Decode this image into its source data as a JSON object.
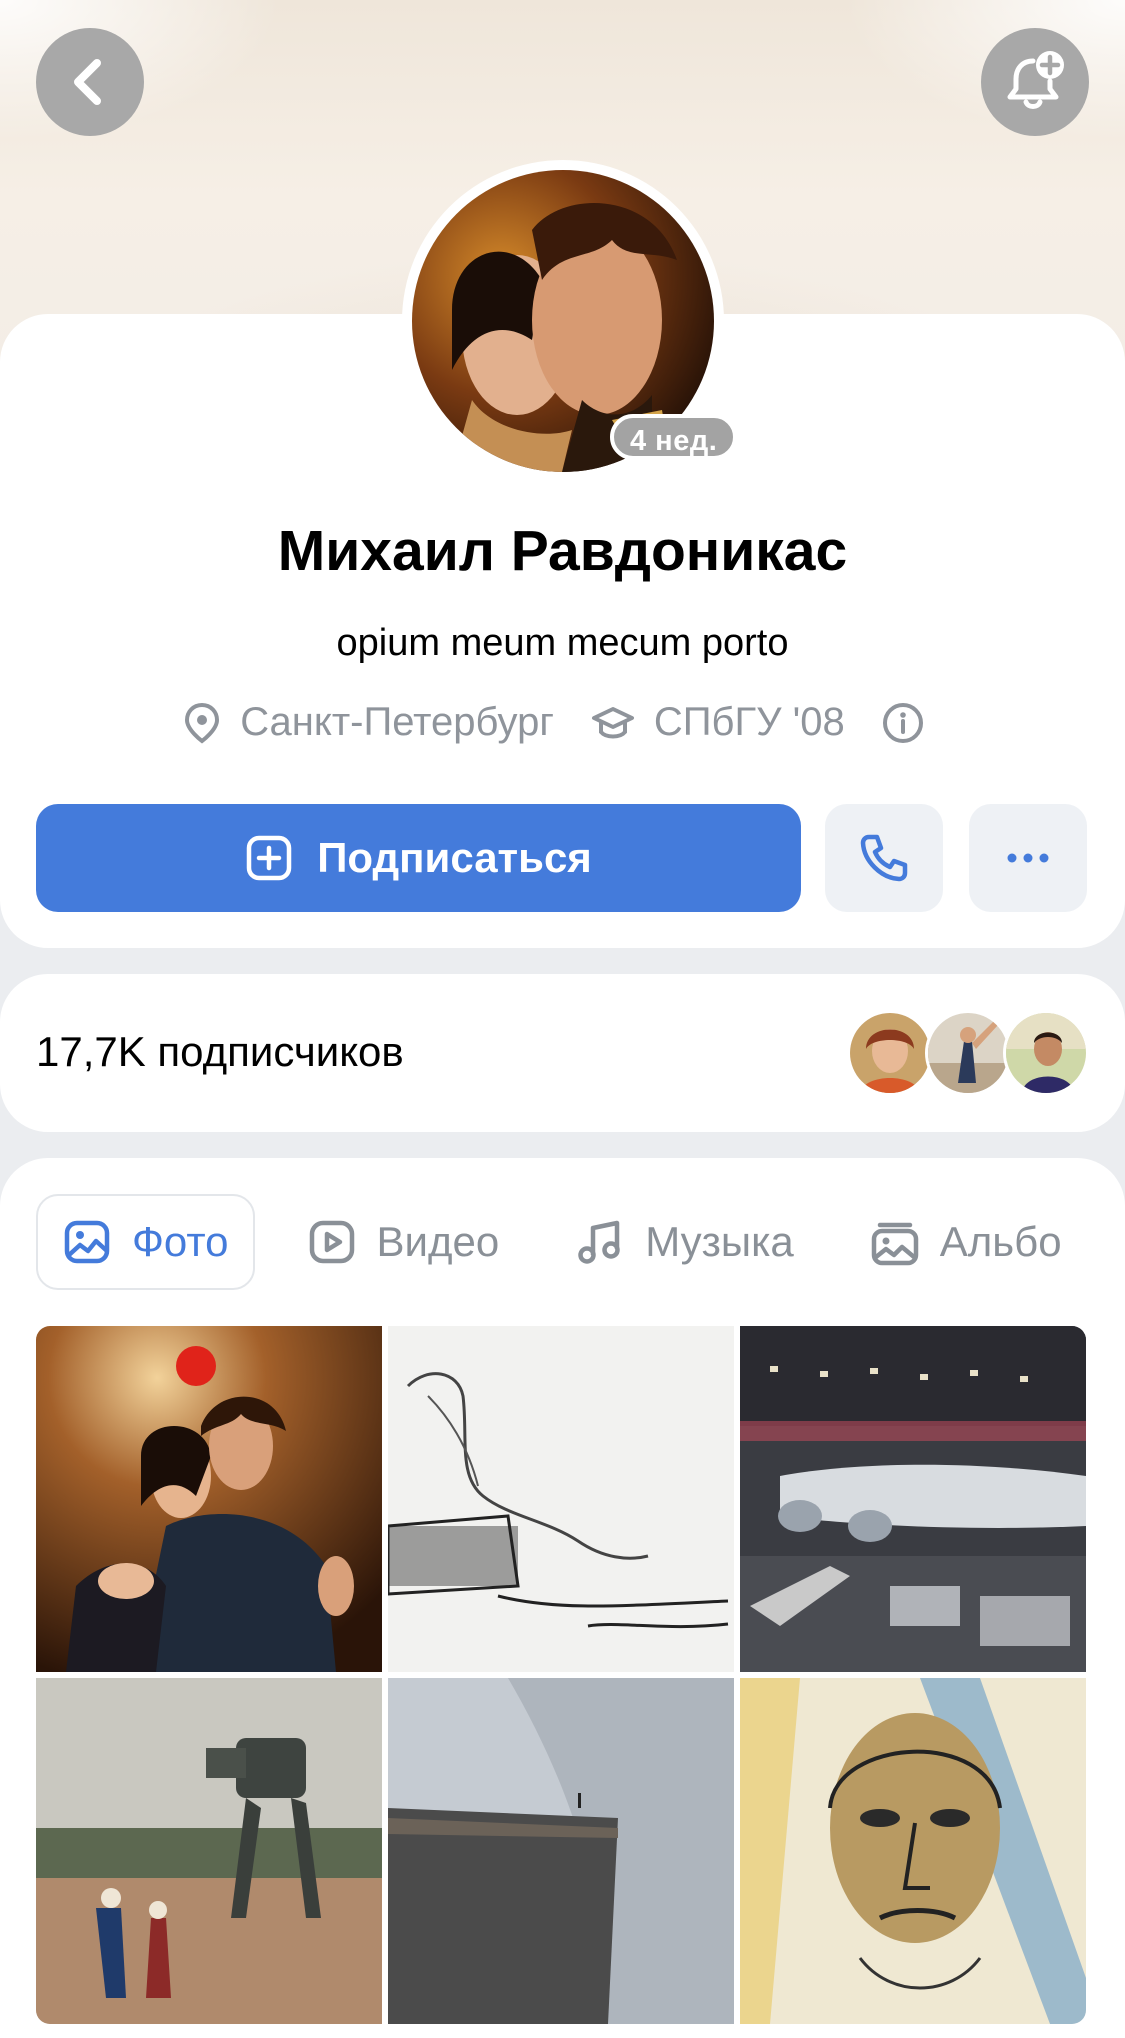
{
  "header": {
    "back_icon": "chevron-left-icon",
    "notify_icon": "bell-plus-icon"
  },
  "profile": {
    "online_badge": "4 нед.",
    "name": "Михаил Равдоникас",
    "status": "opium meum mecum porto",
    "city": "Санкт-Петербург",
    "education": "СПбГУ '08",
    "city_icon": "location-pin-icon",
    "education_icon": "graduation-cap-icon",
    "info_icon": "info-icon"
  },
  "actions": {
    "subscribe_label": "Подписаться",
    "subscribe_icon": "add-square-icon",
    "call_icon": "phone-icon",
    "more_icon": "more-dots-icon",
    "accent_color": "#447bdb"
  },
  "subscribers": {
    "count_label": "17,7K подписчиков"
  },
  "media_tabs": [
    {
      "label": "Фото",
      "icon": "image-icon",
      "active": true
    },
    {
      "label": "Видео",
      "icon": "video-icon",
      "active": false
    },
    {
      "label": "Музыка",
      "icon": "music-note-icon",
      "active": false
    },
    {
      "label": "Альбо",
      "icon": "albums-icon",
      "active": false
    }
  ],
  "photo_grid": {
    "count": 6
  }
}
